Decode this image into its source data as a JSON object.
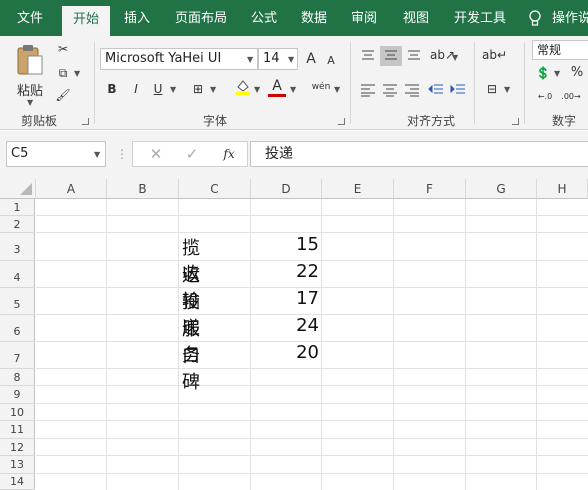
{
  "tabs": [
    {
      "label": "文件",
      "active": false
    },
    {
      "label": "开始",
      "active": true
    },
    {
      "label": "插入",
      "active": false
    },
    {
      "label": "页面布局",
      "active": false
    },
    {
      "label": "公式",
      "active": false
    },
    {
      "label": "数据",
      "active": false
    },
    {
      "label": "审阅",
      "active": false
    },
    {
      "label": "视图",
      "active": false
    },
    {
      "label": "开发工具",
      "active": false
    }
  ],
  "tell_me": "操作说",
  "ribbon": {
    "clipboard": {
      "paste_label": "粘贴",
      "group_label": "剪贴板"
    },
    "font": {
      "font_name": "Microsoft YaHei UI",
      "font_size": "14",
      "group_label": "字体",
      "bold": "B",
      "italic": "I",
      "underline": "U",
      "grow": "A",
      "shrink": "A",
      "color_a": "A",
      "phonetic": "wén"
    },
    "alignment": {
      "group_label": "对齐方式"
    },
    "number": {
      "format": "常规",
      "group_label": "数字",
      "percent": "%"
    }
  },
  "formula_bar": {
    "name_box": "C5",
    "fx": "fx",
    "value": "投递"
  },
  "columns": [
    "A",
    "B",
    "C",
    "D",
    "E",
    "F",
    "G",
    "H"
  ],
  "rows": [
    "1",
    "2",
    "3",
    "4",
    "5",
    "6",
    "7",
    "8",
    "9",
    "10",
    "11",
    "12",
    "13",
    "14"
  ],
  "table": [
    {
      "row": "3",
      "label": "揽收",
      "value": "15"
    },
    {
      "row": "4",
      "label": "运输",
      "value": "22"
    },
    {
      "row": "5",
      "label": "投递",
      "value": "17"
    },
    {
      "row": "6",
      "label": "服务",
      "value": "24"
    },
    {
      "row": "7",
      "label": "口碑",
      "value": "20"
    }
  ],
  "colors": {
    "excel_green": "#217346",
    "font_color_bar": "#d00000",
    "highlight_bar": "#ffff00"
  }
}
